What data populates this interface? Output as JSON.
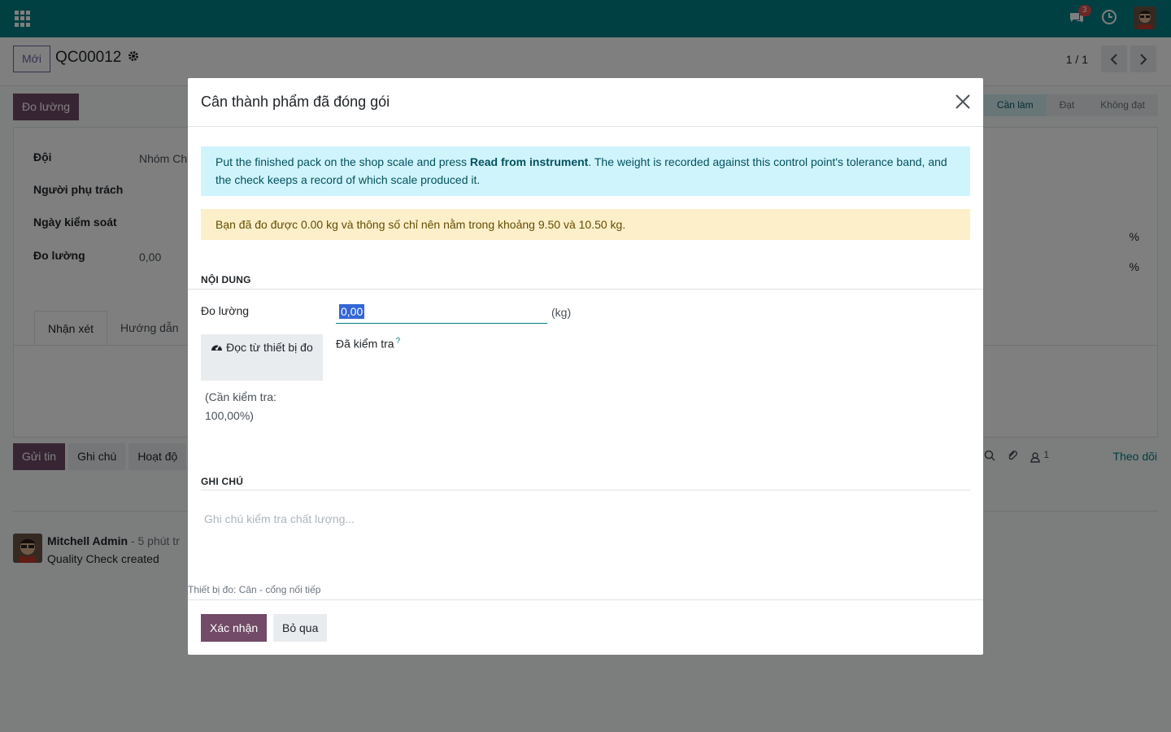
{
  "navbar": {
    "apps_icon": "apps-grid-icon",
    "chat_icon": "chat-icon",
    "chat_badge": "3",
    "activity_icon": "clock-icon",
    "colors": {
      "navbar": "#017e84"
    }
  },
  "control_panel": {
    "new_label": "Mới",
    "record_name": "QC00012",
    "settings_icon": "gear-icon",
    "pager_value": "1 / 1"
  },
  "form": {
    "measure_button": "Đo lường",
    "stages": [
      "Cần làm",
      "Đạt",
      "Không đạt"
    ],
    "fields": {
      "team_label": "Đội",
      "team_value": "Nhóm Ch",
      "responsible_label": "Người phụ trách",
      "control_date_label": "Ngày kiểm soát",
      "measure_label": "Đo lường",
      "measure_value": "0,00"
    },
    "percent_signs": [
      "%",
      "%"
    ],
    "tabs": [
      "Nhận xét",
      "Hướng dẫn"
    ]
  },
  "chatter": {
    "send_message": "Gửi tin",
    "log_note": "Ghi chú",
    "activities": "Hoạt độ",
    "followers_count": "1",
    "follow_label": "Theo dõi",
    "message": {
      "author": "Mitchell Admin",
      "time": " - 5 phút tr",
      "body": "Quality Check created"
    }
  },
  "modal": {
    "title": "Cân thành phẩm đã đóng gói",
    "info_prefix": "Put the finished pack on the shop scale and press ",
    "info_bold": "Read from instrument",
    "info_suffix": ". The weight is recorded against this control point's tolerance band, and the check keeps a record of which scale produced it.",
    "warning": "Bạn đã đo được 0.00 kg và thông số chỉ nên nằm trong khoảng 9.50 và 10.50 kg.",
    "section_content": "NỘI DUNG",
    "measure_label": "Đo lường",
    "measure_value": "0,00",
    "unit": "(kg)",
    "read_button": "Đọc từ thiết bị đo",
    "read_icon": "tachometer-icon",
    "checked_label": "Đã kiểm tra",
    "checked_help": "?",
    "to_check": "(Cần kiểm tra: 100,00%)",
    "section_notes": "GHI CHÚ",
    "notes_placeholder": "Ghi chú kiểm tra chất lượng...",
    "device": "Thiết bị đo: Cân - cổng nối tiếp",
    "confirm_button": "Xác nhận",
    "skip_button": "Bỏ qua",
    "colors": {
      "primary": "#714b67",
      "info_bg": "#cff4fc",
      "warning_bg": "#fcefca"
    }
  }
}
